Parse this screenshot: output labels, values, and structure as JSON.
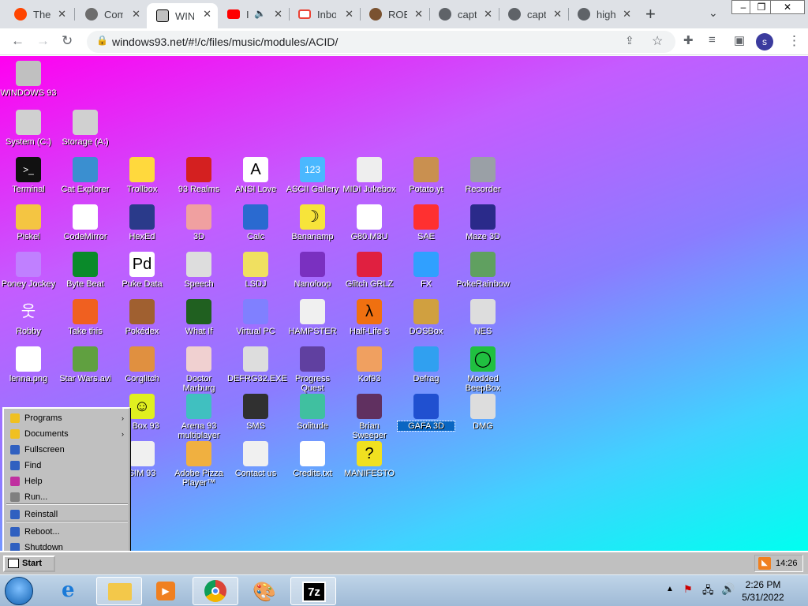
{
  "browser": {
    "tabs": [
      {
        "title": "The",
        "icon": "reddit-icon",
        "color": "#ff4500"
      },
      {
        "title": "Com",
        "icon": "gear-icon",
        "color": "#6d6d6d"
      },
      {
        "title": "WIN",
        "icon": "windows93-icon",
        "color": "#c0c0c0"
      },
      {
        "title": "I",
        "icon": "youtube-icon",
        "color": "#ff0000"
      },
      {
        "title": "Inbo",
        "icon": "gmail-icon",
        "color": "#ea4335"
      },
      {
        "title": "ROB",
        "icon": "avatar-icon",
        "color": "#7a5230"
      },
      {
        "title": "capt",
        "icon": "globe-icon",
        "color": "#5f6368"
      },
      {
        "title": "capt",
        "icon": "globe-icon",
        "color": "#5f6368"
      },
      {
        "title": "high",
        "icon": "globe-icon",
        "color": "#5f6368"
      }
    ],
    "url": "windows93.net/#!/c/files/music/modules/ACID/",
    "profile_initial": "s"
  },
  "desktop": {
    "icons": [
      {
        "label": "WINDOWS 93",
        "icon": "computer-icon",
        "bg": "#c0c0c0"
      },
      {
        "label": "System (C:)",
        "icon": "drive-icon",
        "bg": "#d0d0d0"
      },
      {
        "label": "Storage (A:)",
        "icon": "floppy-drive-icon",
        "bg": "#d0d0d0"
      },
      {
        "label": "Terminal",
        "icon": "terminal-icon",
        "bg": "#111111"
      },
      {
        "label": "Cat Explorer",
        "icon": "globe-cat-icon",
        "bg": "#3a8fd0"
      },
      {
        "label": "Trollbox",
        "icon": "chat-smiley-icon",
        "bg": "#ffd93d"
      },
      {
        "label": "93 Realms",
        "icon": "dragon-icon",
        "bg": "#d42020"
      },
      {
        "label": "ANSI Love",
        "icon": "letter-a-icon",
        "bg": "#ffffff"
      },
      {
        "label": "ASCII Gallery",
        "icon": "numbers-icon",
        "bg": "#4ab8ff"
      },
      {
        "label": "MIDI Jukebox",
        "icon": "keyboard-icon",
        "bg": "#eeeeee"
      },
      {
        "label": "Potato.yt",
        "icon": "potato-icon",
        "bg": "#c99050"
      },
      {
        "label": "Recorder",
        "icon": "microphone-icon",
        "bg": "#9aa0a6"
      },
      {
        "label": "Piskel",
        "icon": "palette-icon",
        "bg": "#f4c542"
      },
      {
        "label": "CodeMirror",
        "icon": "cat-code-icon",
        "bg": "#ffffff"
      },
      {
        "label": "HexEd",
        "icon": "cube-icon",
        "bg": "#2a3a8a"
      },
      {
        "label": "3D",
        "icon": "teapot-icon",
        "bg": "#f0a0a0"
      },
      {
        "label": "Calc",
        "icon": "calculator-icon",
        "bg": "#2a6ad0"
      },
      {
        "label": "Bananamp",
        "icon": "banana-icon",
        "bg": "#f7e43a"
      },
      {
        "label": "G80.M3U",
        "icon": "audio-file-icon",
        "bg": "#ffffff"
      },
      {
        "label": "SAE",
        "icon": "ball-icon",
        "bg": "#ff3030"
      },
      {
        "label": "Maze 3D",
        "icon": "maze-icon",
        "bg": "#2a2a8a"
      },
      {
        "label": "Poney Jockey",
        "icon": "pony-icon",
        "bg": "#c080ff"
      },
      {
        "label": "Byte Beat",
        "icon": "waveform-icon",
        "bg": "#0a8a2a"
      },
      {
        "label": "Puke Data",
        "icon": "pd-icon",
        "bg": "#ffffff"
      },
      {
        "label": "Speech",
        "icon": "face-icon",
        "bg": "#dddddd"
      },
      {
        "label": "LSDJ",
        "icon": "gameboy-icon",
        "bg": "#f0e060"
      },
      {
        "label": "Nanoloop",
        "icon": "lines-icon",
        "bg": "#7a30c0"
      },
      {
        "label": "Glitch GRLZ",
        "icon": "lips-icon",
        "bg": "#e02040"
      },
      {
        "label": "FX",
        "icon": "atom-icon",
        "bg": "#30a0ff"
      },
      {
        "label": "PokeRainbow",
        "icon": "trainers-icon",
        "bg": "#60a060"
      },
      {
        "label": "Robby",
        "icon": "stickman-icon",
        "bg": "transparent"
      },
      {
        "label": "Take this",
        "icon": "wizard-icon",
        "bg": "#f06020"
      },
      {
        "label": "Pokédex",
        "icon": "bag-icon",
        "bg": "#a06030"
      },
      {
        "label": "What If",
        "icon": "bars-icon",
        "bg": "#206020"
      },
      {
        "label": "Virtual PC",
        "icon": "window-icon",
        "bg": "#8080ff"
      },
      {
        "label": "HAMPSTER",
        "icon": "hamster-icon",
        "bg": "#f0f0f0"
      },
      {
        "label": "Half-Life 3",
        "icon": "lambda-icon",
        "bg": "#f07010"
      },
      {
        "label": "DOSBox",
        "icon": "box-icon",
        "bg": "#d0a040"
      },
      {
        "label": "NES",
        "icon": "nes-icon",
        "bg": "#dddddd"
      },
      {
        "label": "lenna.png",
        "icon": "image-file-icon",
        "bg": "#ffffff"
      },
      {
        "label": "Star Wars.avi",
        "icon": "yoda-icon",
        "bg": "#60a040"
      },
      {
        "label": "Corglitch",
        "icon": "corgi-icon",
        "bg": "#e09040"
      },
      {
        "label": "Doctor Marburg",
        "icon": "doctor-icon",
        "bg": "#f0d0d0"
      },
      {
        "label": "DEFRG32.EXE",
        "icon": "monitor-face-icon",
        "bg": "#dddddd"
      },
      {
        "label": "Progress Quest",
        "icon": "swords-icon",
        "bg": "#6040a0"
      },
      {
        "label": "Kof93",
        "icon": "fighter-icon",
        "bg": "#f0a060"
      },
      {
        "label": "Defrag",
        "icon": "defrag-icon",
        "bg": "#30a0f0"
      },
      {
        "label": "Modded BeepBox",
        "icon": "ring-icon",
        "bg": "#20c040"
      },
      {
        "label": "d Box 93",
        "icon": "smiley-icon",
        "bg": "#e0f020"
      },
      {
        "label": "Arena 93 multiplayer",
        "icon": "arena-cube-icon",
        "bg": "#40c0c0"
      },
      {
        "label": "SMS",
        "icon": "console-icon",
        "bg": "#303030"
      },
      {
        "label": "Solitude",
        "icon": "bottle-icon",
        "bg": "#40c0a0"
      },
      {
        "label": "Brian Sweeper",
        "icon": "mine-icon",
        "bg": "#603060"
      },
      {
        "label": "GAFA 3D",
        "icon": "blue-head-icon",
        "bg": "#2050d0"
      },
      {
        "label": "DMG",
        "icon": "gameboy-cart-icon",
        "bg": "#dddddd"
      },
      {
        "label": "SIM 93",
        "icon": "book-icon",
        "bg": "#f0f0f0"
      },
      {
        "label": "Adobe Pizza Player™",
        "icon": "pizza-icon",
        "bg": "#f0b040"
      },
      {
        "label": "Contact us",
        "icon": "mail-note-icon",
        "bg": "#f0f0f0"
      },
      {
        "label": "Credits.txt",
        "icon": "text-file-icon",
        "bg": "#ffffff"
      },
      {
        "label": "MANIFESTO",
        "icon": "question-icon",
        "bg": "#f0e020"
      }
    ]
  },
  "start_menu": {
    "items": [
      {
        "label": "Programs",
        "has_sub": "›",
        "color": "#f0c020"
      },
      {
        "label": "Documents",
        "has_sub": "›",
        "color": "#f0c020"
      },
      {
        "label": "Fullscreen",
        "has_sub": "",
        "color": "#3060c0"
      },
      {
        "label": "Find",
        "has_sub": "",
        "color": "#3060c0"
      },
      {
        "label": "Help",
        "has_sub": "",
        "color": "#c030a0"
      },
      {
        "label": "Run...",
        "has_sub": "",
        "color": "#808080"
      },
      {
        "label": "Reinstall",
        "has_sub": "",
        "color": "#3060c0"
      },
      {
        "label": "Reboot...",
        "has_sub": "",
        "color": "#3060c0"
      },
      {
        "label": "Shutdown",
        "has_sub": "",
        "color": "#3060c0"
      }
    ]
  },
  "w93_taskbar": {
    "start_label": "Start",
    "tray_time": "14:26"
  },
  "win7_taskbar": {
    "pinned": [
      {
        "icon": "start-orb-icon"
      },
      {
        "icon": "internet-explorer-icon"
      },
      {
        "icon": "file-explorer-icon"
      },
      {
        "icon": "media-player-icon"
      },
      {
        "icon": "chrome-icon"
      },
      {
        "icon": "paint-icon"
      },
      {
        "icon": "7zip-icon"
      }
    ],
    "sevenzip_label": "7z",
    "clock_time": "2:26 PM",
    "clock_date": "5/31/2022"
  }
}
